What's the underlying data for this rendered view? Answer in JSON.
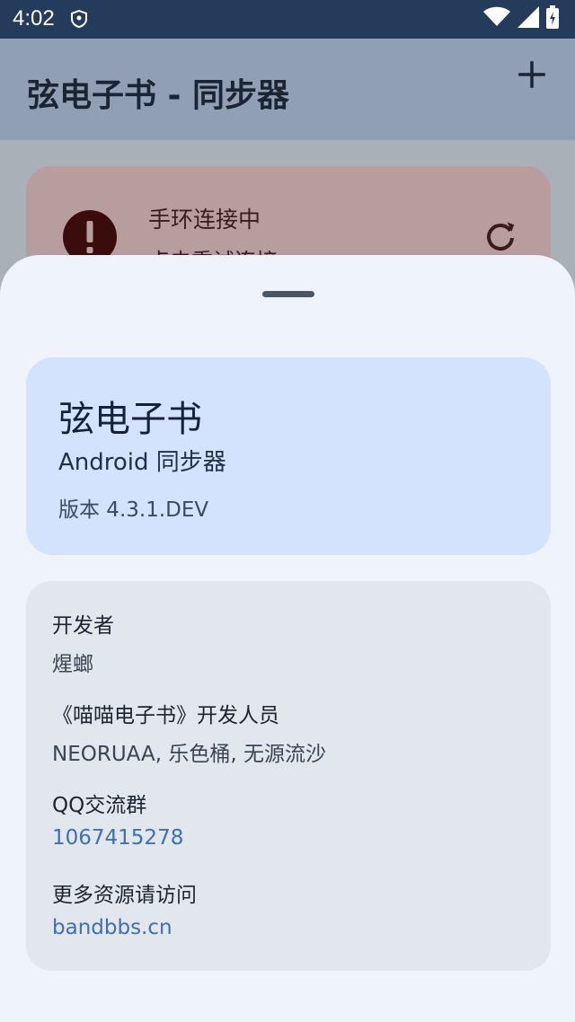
{
  "status_bar": {
    "time": "4:02"
  },
  "app_bar": {
    "title": "弦电子书 - 同步器"
  },
  "status_card": {
    "title": "手环连接中",
    "subtitle": "点击重试连接"
  },
  "about": {
    "app_name": "弦电子书",
    "app_subtitle": "Android 同步器",
    "version": "版本 4.3.1.DEV"
  },
  "info": {
    "developer_label": "开发者",
    "developer_value": "煋螂",
    "miaomiao_label": "《喵喵电子书》开发人员",
    "miaomiao_value": "NEORUAA, 乐色桶, 无源流沙",
    "qq_label": "QQ交流群",
    "qq_value": "1067415278",
    "more_label": "更多资源请访问",
    "more_value": "bandbbs.cn"
  },
  "colors": {
    "status_bar": "#243b5c",
    "app_card": "#d3e3fd",
    "info_card": "#e2e7ee",
    "link": "#3e6fae",
    "sheet": "#eef3fc"
  }
}
